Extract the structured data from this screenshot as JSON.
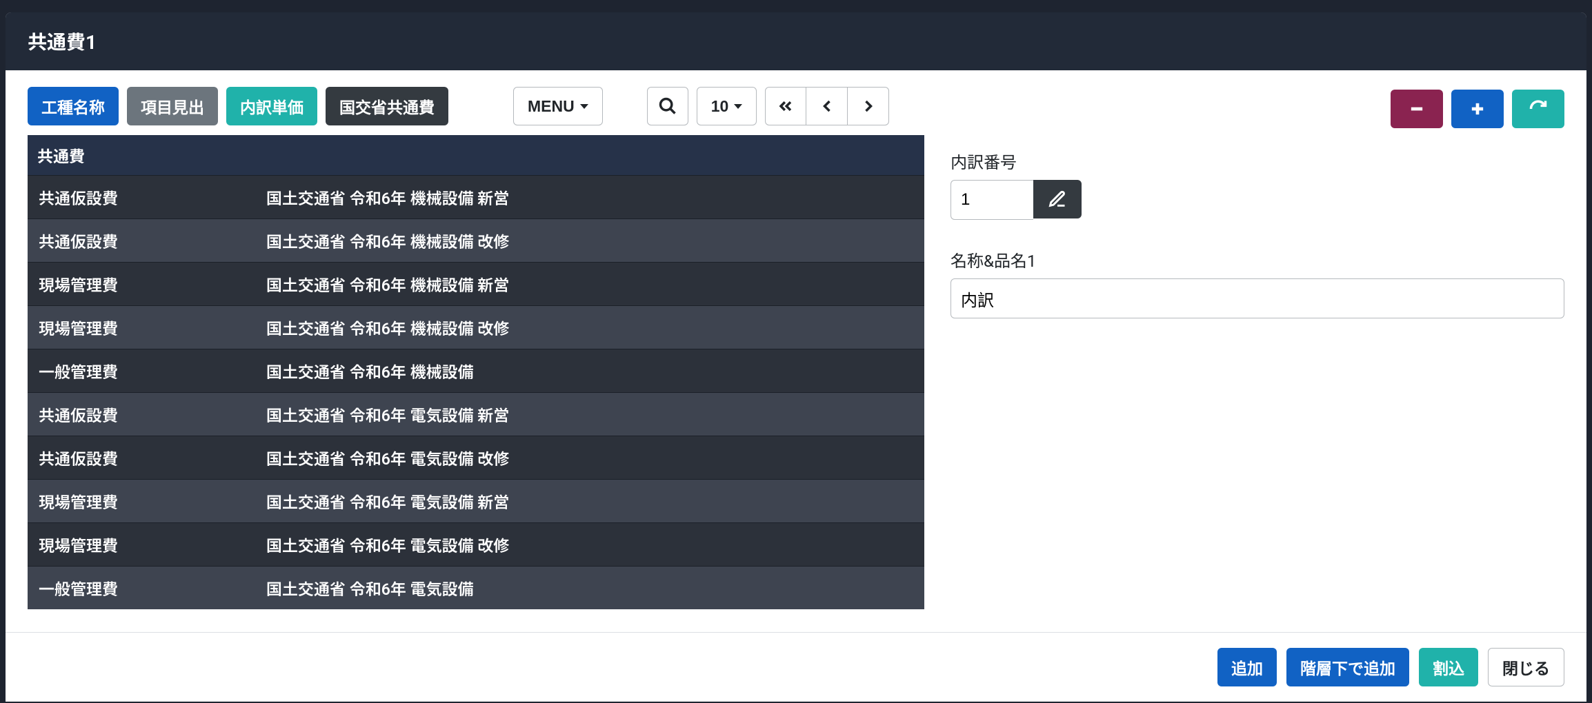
{
  "header": {
    "title": "共通費1"
  },
  "toolbar": {
    "type_name": "工種名称",
    "item_heading": "項目見出",
    "detail_price": "内訳単価",
    "mlit_common": "国交省共通費",
    "menu": "MENU",
    "page_size": "10"
  },
  "table": {
    "group_header": "共通費",
    "rows": [
      {
        "a": "共通仮設費",
        "b": "国土交通省 令和6年 機械設備 新営"
      },
      {
        "a": "共通仮設費",
        "b": "国土交通省 令和6年 機械設備 改修"
      },
      {
        "a": "現場管理費",
        "b": "国土交通省 令和6年 機械設備 新営"
      },
      {
        "a": "現場管理費",
        "b": "国土交通省 令和6年 機械設備 改修"
      },
      {
        "a": "一般管理費",
        "b": "国土交通省 令和6年 機械設備"
      },
      {
        "a": "共通仮設費",
        "b": "国土交通省 令和6年 電気設備 新営"
      },
      {
        "a": "共通仮設費",
        "b": "国土交通省 令和6年 電気設備 改修"
      },
      {
        "a": "現場管理費",
        "b": "国土交通省 令和6年 電気設備 新営"
      },
      {
        "a": "現場管理費",
        "b": "国土交通省 令和6年 電気設備 改修"
      },
      {
        "a": "一般管理費",
        "b": "国土交通省 令和6年 電気設備"
      }
    ]
  },
  "form": {
    "detail_number_label": "内訳番号",
    "detail_number_value": "1",
    "name_label": "名称&品名1",
    "name_value": "内訳"
  },
  "footer": {
    "add": "追加",
    "add_below": "階層下で追加",
    "insert": "割込",
    "close": "閉じる"
  }
}
